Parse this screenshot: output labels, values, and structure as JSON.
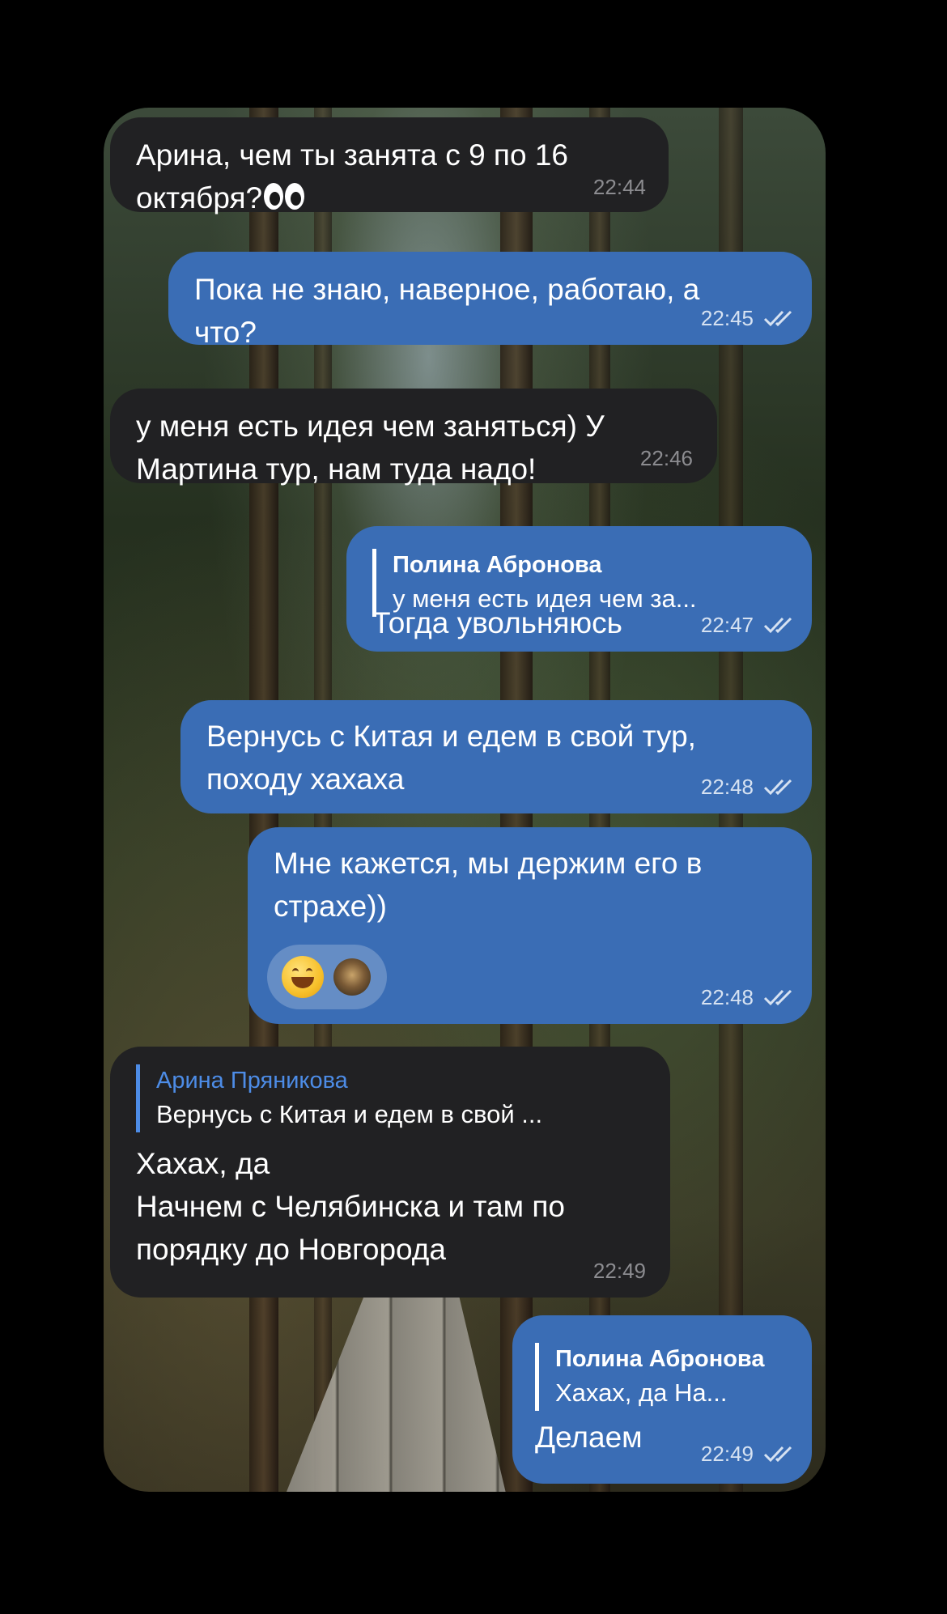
{
  "messages": [
    {
      "sender": "in",
      "text": "Арина, чем ты занята с 9 по 16\nоктября?",
      "emoji_icon": "eyes-emoji",
      "time": "22:44"
    },
    {
      "sender": "out",
      "text": "Пока не знаю, наверное, работаю, а\nчто?",
      "time": "22:45",
      "status": "read"
    },
    {
      "sender": "in",
      "text": "у меня есть идея чем заняться) У\nМартина тур, нам туда надо!",
      "time": "22:46"
    },
    {
      "sender": "out",
      "reply_name": "Полина Абронова",
      "reply_text": "у меня есть идея чем за...",
      "text": "Тогда увольняюсь",
      "time": "22:47",
      "status": "read"
    },
    {
      "sender": "out",
      "text": "Вернусь с Китая и едем в свой тур,\nпоходу хахаха",
      "time": "22:48",
      "status": "read"
    },
    {
      "sender": "out",
      "text": "Мне кажется, мы держим его в\nстрахе))",
      "time": "22:48",
      "status": "read",
      "reactions": [
        "grinning-face-emoji",
        "reactor-avatar"
      ]
    },
    {
      "sender": "in",
      "reply_name": "Арина Пряникова",
      "reply_text": "Вернусь с Китая и едем в свой ...",
      "text": "Хахах, да\nНачнем с Челябинска и там по\nпорядку до Новгорода",
      "time": "22:49"
    },
    {
      "sender": "out",
      "reply_name": "Полина Абронова",
      "reply_text": "Хахах, да На...",
      "text": "Делаем",
      "time": "22:49",
      "status": "read"
    }
  ],
  "colors": {
    "incoming_bubble": "#212123",
    "outgoing_bubble": "#3a6db5",
    "incoming_reply_accent": "#4d8ce6",
    "page_background": "#000000"
  }
}
